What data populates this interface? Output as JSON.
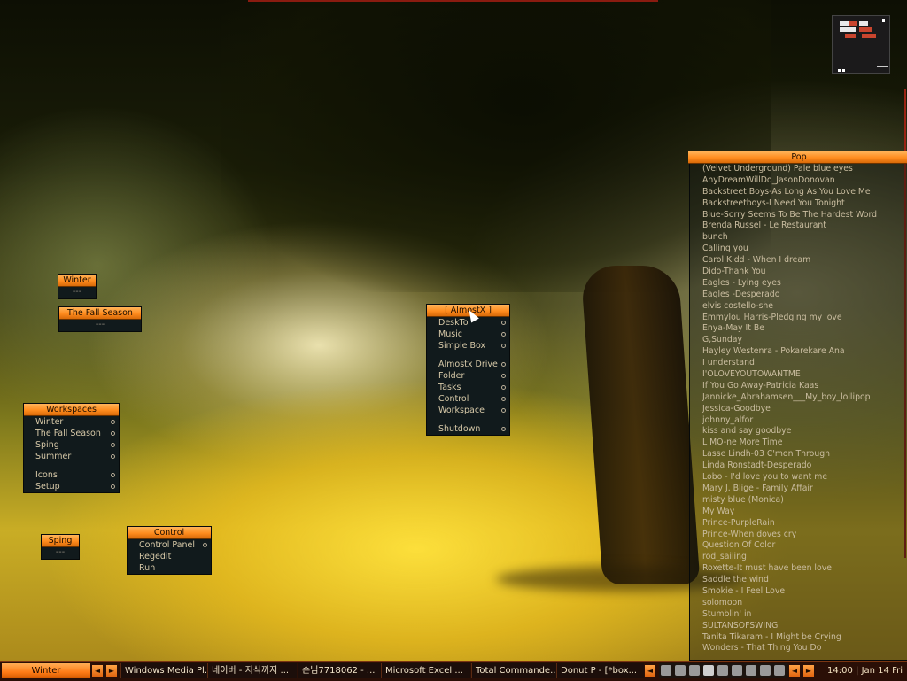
{
  "menus": {
    "winter": {
      "title": "Winter",
      "empty": "---"
    },
    "fall": {
      "title": "The Fall Season",
      "empty": "---"
    },
    "spring": {
      "title": "Sping",
      "empty": "---"
    },
    "workspaces": {
      "title": "Workspaces",
      "items": [
        "Winter",
        "The Fall Season",
        "Sping",
        "Summer",
        "Icons",
        "Setup"
      ]
    },
    "control": {
      "title": "Control",
      "items": [
        "Control Panel",
        "Regedit",
        "Run"
      ]
    },
    "almostx": {
      "title": "[  AlmostX  ]",
      "items": [
        "DeskTo",
        "Music",
        "Simple Box",
        "Almostx Drive",
        "Folder",
        "Tasks",
        "Control",
        "Workspace",
        "Shutdown"
      ]
    }
  },
  "pop": {
    "title": "Pop",
    "items": [
      "(Velvet Underground) Pale blue eyes",
      "AnyDreamWillDo_JasonDonovan",
      "Backstreet Boys-As Long As You Love Me",
      "Backstreetboys-I Need You Tonight",
      "Blue-Sorry Seems To Be The Hardest Word",
      "Brenda Russel - Le Restaurant",
      "bunch",
      "Calling you",
      "Carol Kidd - When I dream",
      "Dido-Thank You",
      "Eagles - Lying eyes",
      "Eagles -Desperado",
      "elvis costello-she",
      "Emmylou Harris-Pledging my love",
      "Enya-May It Be",
      "G,Sunday",
      "Hayley Westenra - Pokarekare Ana",
      "I understand",
      "I'OLOVEYOUTOWANTME",
      "If You Go Away-Patricia Kaas",
      "Jannicke_Abrahamsen___My_boy_lollipop",
      "Jessica-Goodbye",
      "johnny_alfor",
      "kiss and say goodbye",
      "L MO-ne More Time",
      "Lasse Lindh-03 C'mon Through",
      "Linda Ronstadt-Desperado",
      "Lobo - I'd love you to want me",
      "Mary J. Blige - Family Affair",
      "misty blue (Monica)",
      "My Way",
      "Prince-PurpleRain",
      "Prince-When  doves cry",
      "Question Of Color",
      "rod_sailing",
      "Roxette-It must have been love",
      "Saddle the wind",
      "Smokie - I Feel Love",
      "solomoon",
      "Stumblin' in",
      "SULTANSOFSWING",
      "Tanita Tikaram - I Might be Crying",
      "Wonders - That Thing You Do"
    ]
  },
  "taskbar": {
    "workspace": "Winter",
    "arrow_left": "◄",
    "arrow_right": "►",
    "tasks": [
      "Windows Media Pl...",
      "네이버 - 지식까지 ...",
      "손님7718062 - ...",
      "Microsoft Excel ...",
      "Total Commande...",
      "Donut P - [*box..."
    ],
    "clock": "14:00 | Jan 14 Fri"
  },
  "colors": {
    "title_orange": "#ff8c1e",
    "menu_bg": "#111a1c",
    "taskbar_bg": "#2a0f06",
    "accent_red": "#9a2314"
  },
  "icons": [
    "workspace-pager-icon",
    "tray-icons"
  ]
}
